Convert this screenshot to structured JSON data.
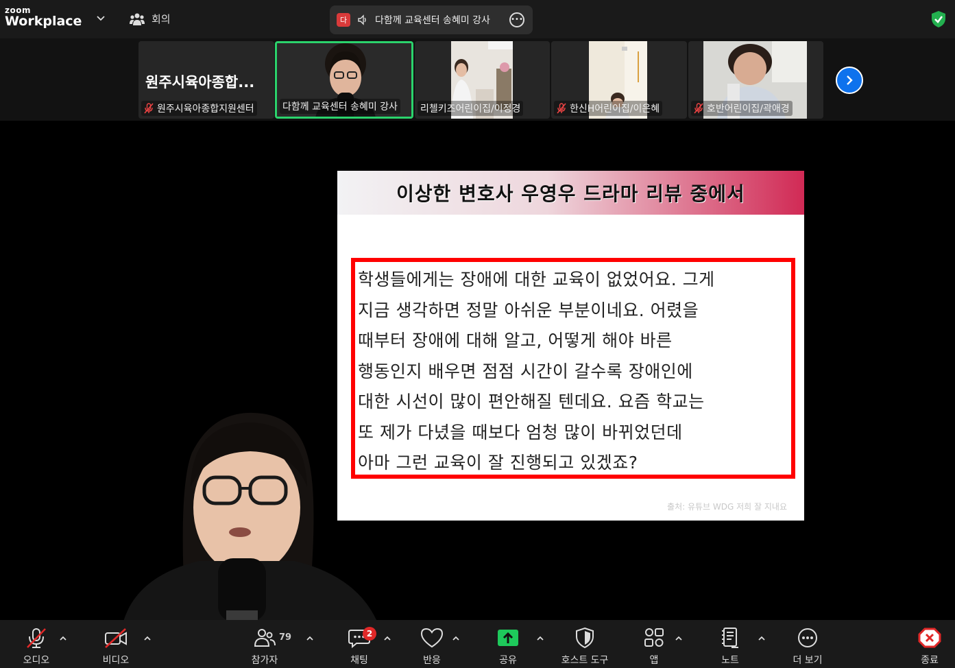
{
  "topbar": {
    "logo_small": "zoom",
    "logo_big": "Workplace",
    "meeting_label": "회의",
    "talking_avatar": "다",
    "talking_name": "다함께 교육센터 송혜미 강사"
  },
  "participants": [
    {
      "name": "원주시육아종합지원센터",
      "big_label": "원주시육아종합...",
      "muted": true
    },
    {
      "name": "다함께 교육센터 송혜미 강사",
      "muted": false,
      "active": true
    },
    {
      "name": "리첼키즈어린이집/이정경",
      "muted": false
    },
    {
      "name": "한신H어린이집/이은혜",
      "muted": true
    },
    {
      "name": "호반어린이집/곽애경",
      "muted": true
    }
  ],
  "slide": {
    "title": "이상한 변호사 우영우 드라마 리뷰 중에서",
    "quote_lines": [
      "학생들에게는 장애에 대한 교육이 없었어요. 그게",
      "지금 생각하면 정말 아쉬운 부분이네요. 어렸을",
      "때부터 장애에 대해 알고, 어떻게 해야 바른",
      "행동인지 배우면 점점 시간이 갈수록 장애인에",
      "대한 시선이 많이 편안해질 텐데요. 요즘 학교는",
      "또 제가 다녔을 때보다 엄청 많이 바뀌었던데",
      "아마 그런 교육이 잘 진행되고 있겠죠?"
    ],
    "source": "출처: 유튜브 WDG 저희 잘 지내요"
  },
  "toolbar": {
    "audio": "오디오",
    "video": "비디오",
    "participants": "참가자",
    "participants_count": "79",
    "chat": "채팅",
    "chat_badge": "2",
    "reactions": "반응",
    "share": "공유",
    "host_tools": "호스트 도구",
    "apps": "앱",
    "notes": "노트",
    "more": "더 보기",
    "end": "종료"
  },
  "colors": {
    "accent_green": "#2bd36c",
    "share_green": "#1ec95b",
    "next_blue": "#0e72ed",
    "end_red": "#e02828",
    "quote_border": "#ff0000"
  }
}
